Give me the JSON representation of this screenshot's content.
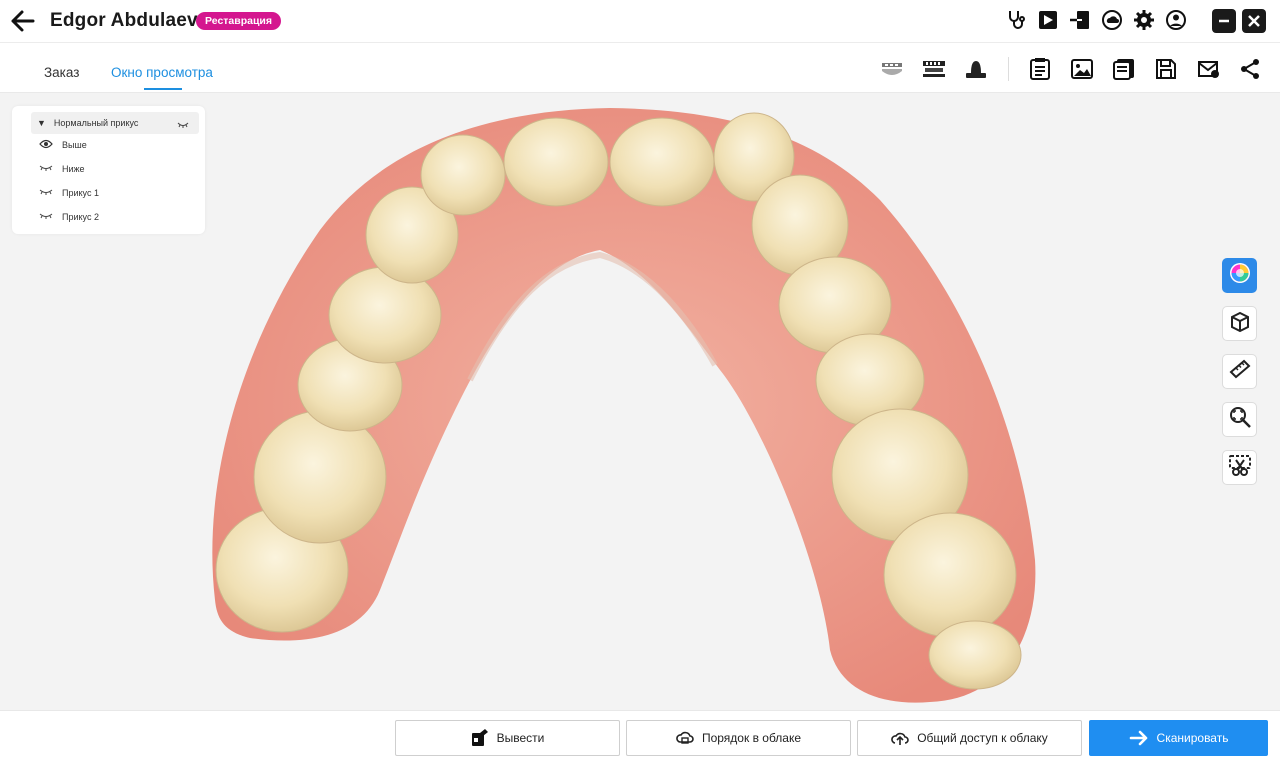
{
  "header": {
    "patient_name": "Edgor Abdulaev",
    "case_badge": "Реставрация",
    "badge_color": "#d4168f",
    "icons": [
      "stethoscope-icon",
      "flag-icon",
      "export-icon",
      "cloud-scan-icon",
      "settings-icon",
      "account-icon"
    ],
    "window_controls": [
      "minimize-icon",
      "close-icon"
    ]
  },
  "tabs": [
    {
      "label": "Заказ",
      "active": false
    },
    {
      "label": "Окно просмотра",
      "active": true
    }
  ],
  "accent_color": "#1d8fe0",
  "toolbar": {
    "view_icons": [
      "jaw-occlusion-icon",
      "jaw-arch-icon",
      "model-base-icon"
    ],
    "action_icons": [
      "order-form-icon",
      "image-icon",
      "report-icon",
      "save-icon",
      "mail-icon",
      "share-icon"
    ]
  },
  "layers": {
    "group_label": "Нормальный прикус",
    "items": [
      {
        "label": "Выше",
        "visible": true
      },
      {
        "label": "Ниже",
        "visible": false
      },
      {
        "label": "Прикус 1",
        "visible": false
      },
      {
        "label": "Прикус 2",
        "visible": false
      }
    ]
  },
  "side_tools": [
    "color-texture-icon",
    "cube-view-icon",
    "ruler-icon",
    "zoom-fit-icon",
    "trim-icon"
  ],
  "bottom_buttons": {
    "export_label": "Вывести",
    "cloud_order_label": "Порядок в облаке",
    "cloud_share_label": "Общий доступ к облаку",
    "scan_label": "Сканировать"
  }
}
